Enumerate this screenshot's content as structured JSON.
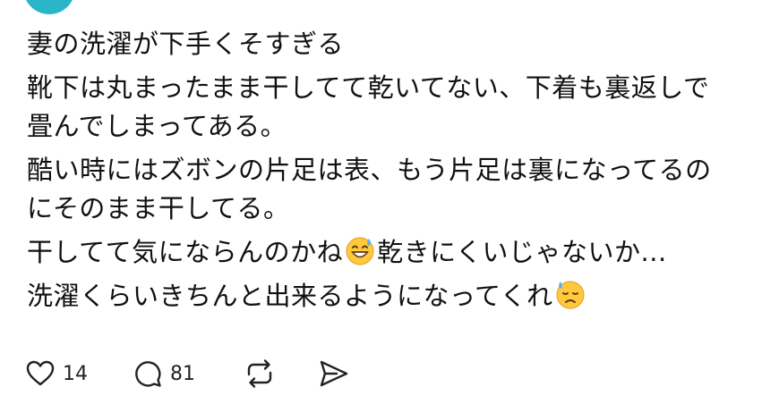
{
  "post": {
    "lines": [
      "妻の洗濯が下手くそすぎる",
      "靴下は丸まったまま干してて乾いてない、下着も裏返しで",
      "畳んでしまってある。",
      "酷い時にはズボンの片足は表、もう片足は裏になってるの",
      "にそのまま干してる。",
      "干してて気にならんのかね",
      "乾きにくいじゃないか...",
      "洗濯くらいきちんと出来るようになってくれ"
    ],
    "emojis": [
      "grinning-sweat-emoji",
      "downcast-sweat-emoji"
    ]
  },
  "actions": {
    "like_count": "14",
    "reply_count": "81"
  },
  "colors": {
    "avatar": "#2bb5c8",
    "text": "#111111",
    "icon": "#222222",
    "emoji_face": "#ffc83d",
    "emoji_sweat": "#5bb3f0"
  }
}
